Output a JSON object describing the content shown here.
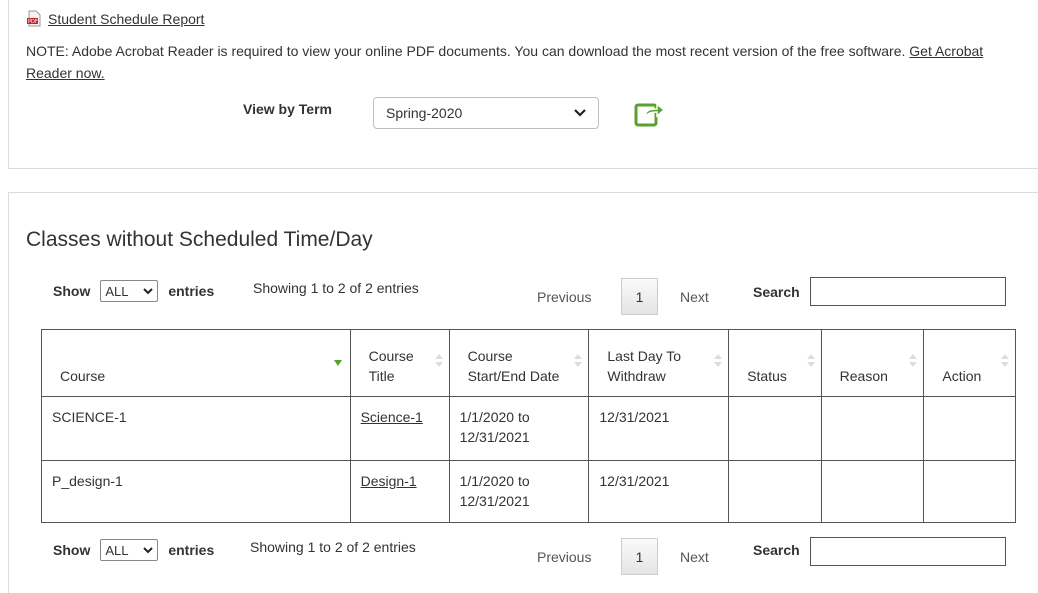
{
  "report": {
    "link_label": "Student Schedule Report",
    "icon": "pdf-icon"
  },
  "note": {
    "text": "NOTE: Adobe Acrobat Reader is required to view your online PDF documents. You can download the most recent version of the free software. ",
    "link_label": "Get Acrobat Reader now."
  },
  "term": {
    "label": "View by Term",
    "selected": "Spring-2020",
    "export_icon": "export-share-icon",
    "export_color": "#5aa02c"
  },
  "section": {
    "title": "Classes without Scheduled Time/Day"
  },
  "controls_top": {
    "show_label": "Show",
    "entries_value": "ALL",
    "entries_label": "entries",
    "info": "Showing 1 to 2 of 2 entries",
    "prev_label": "Previous",
    "page": "1",
    "next_label": "Next",
    "search_label": "Search",
    "search_value": ""
  },
  "controls_bottom": {
    "show_label": "Show",
    "entries_value": "ALL",
    "entries_label": "entries",
    "info": "Showing 1 to 2 of 2 entries",
    "prev_label": "Previous",
    "page": "1",
    "next_label": "Next",
    "search_label": "Search",
    "search_value": ""
  },
  "table": {
    "headers": [
      {
        "line1": "Course",
        "line2": ""
      },
      {
        "line1": "Course",
        "line2": "Title"
      },
      {
        "line1": "Course",
        "line2": "Start/End Date"
      },
      {
        "line1": "Last Day To",
        "line2": "Withdraw"
      },
      {
        "line1": "Status",
        "line2": ""
      },
      {
        "line1": "Reason",
        "line2": ""
      },
      {
        "line1": "Action",
        "line2": ""
      }
    ],
    "rows": [
      {
        "course": "SCIENCE-1",
        "title": "Science-1",
        "date_start": "1/1/2020 to",
        "date_end": "12/31/2021",
        "withdraw": "12/31/2021",
        "status": "",
        "reason": "",
        "action": ""
      },
      {
        "course": "P_design-1",
        "title": "Design-1",
        "date_start": "1/1/2020 to",
        "date_end": "12/31/2021",
        "withdraw": "12/31/2021",
        "status": "",
        "reason": "",
        "action": ""
      }
    ],
    "sort_color": "#5aa02c"
  }
}
